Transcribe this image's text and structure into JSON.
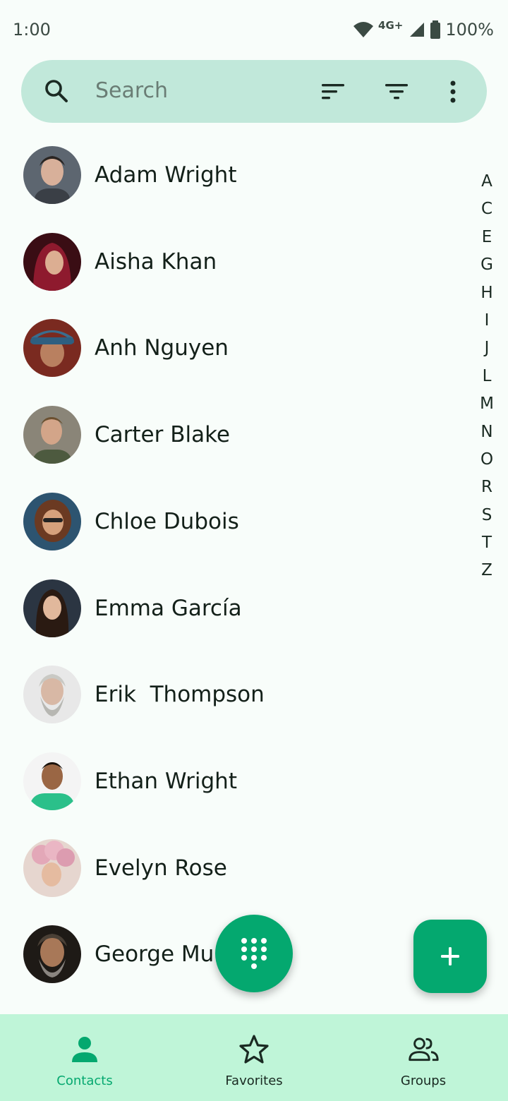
{
  "status_bar": {
    "time": "1:00",
    "network": "4G+",
    "battery": "100%"
  },
  "search": {
    "placeholder": "Search"
  },
  "colors": {
    "accent": "#04a86f",
    "search_bg": "#c1e8da",
    "nav_bg": "#bff5d8"
  },
  "contacts": [
    {
      "name": "Adam Wright"
    },
    {
      "name": "Aisha Khan"
    },
    {
      "name": "Anh Nguyen"
    },
    {
      "name": "Carter Blake"
    },
    {
      "name": "Chloe Dubois"
    },
    {
      "name": "Emma García"
    },
    {
      "name": "Erik  Thompson"
    },
    {
      "name": "Ethan Wright"
    },
    {
      "name": "Evelyn Rose"
    },
    {
      "name": "George Mu"
    }
  ],
  "alphabet_index": [
    "A",
    "C",
    "E",
    "G",
    "H",
    "I",
    "J",
    "L",
    "M",
    "N",
    "O",
    "R",
    "S",
    "T",
    "Z"
  ],
  "nav": {
    "contacts": "Contacts",
    "favorites": "Favorites",
    "groups": "Groups",
    "active": "contacts"
  },
  "icons": {
    "search": "search-icon",
    "sort": "sort-icon",
    "filter": "filter-icon",
    "more": "more-vert-icon",
    "dialpad": "dialpad-icon",
    "add": "add-icon",
    "person": "person-icon",
    "star": "star-icon",
    "group": "group-icon"
  }
}
